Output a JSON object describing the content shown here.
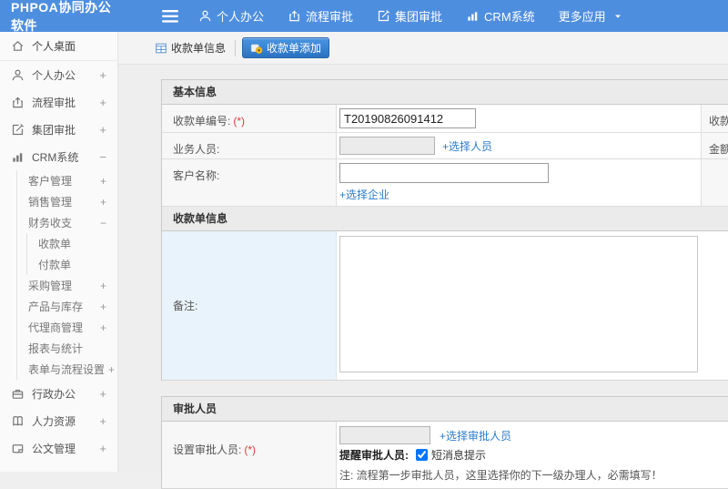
{
  "header": {
    "logo": "PHPOA协同办公软件",
    "nav": [
      {
        "label": "个人办公",
        "icon": "user-icon"
      },
      {
        "label": "流程审批",
        "icon": "process-icon"
      },
      {
        "label": "集团审批",
        "icon": "edit-icon"
      },
      {
        "label": "CRM系统",
        "icon": "chart-icon"
      },
      {
        "label": "更多应用",
        "icon": "caret-down-icon"
      }
    ]
  },
  "sidebar": {
    "items": [
      {
        "label": "个人桌面",
        "icon": "home-icon",
        "expand": ""
      },
      {
        "label": "个人办公",
        "icon": "user-icon",
        "expand": "+"
      },
      {
        "label": "流程审批",
        "icon": "process-icon",
        "expand": "+"
      },
      {
        "label": "集团审批",
        "icon": "edit-icon",
        "expand": "+"
      },
      {
        "label": "CRM系统",
        "icon": "chart-icon",
        "expand": "−"
      },
      {
        "label": "行政办公",
        "icon": "briefcase-icon",
        "expand": "+"
      },
      {
        "label": "人力资源",
        "icon": "book-icon",
        "expand": "+"
      },
      {
        "label": "公文管理",
        "icon": "doc-icon",
        "expand": "+"
      }
    ],
    "crm_children": [
      {
        "label": "客户管理",
        "expand": "+"
      },
      {
        "label": "销售管理",
        "expand": "+"
      },
      {
        "label": "财务收支",
        "expand": "−"
      },
      {
        "label": "采购管理",
        "expand": "+"
      },
      {
        "label": "产品与库存",
        "expand": "+"
      },
      {
        "label": "代理商管理",
        "expand": "+"
      },
      {
        "label": "报表与统计",
        "expand": ""
      },
      {
        "label": "表单与流程设置",
        "expand": "+"
      }
    ],
    "finance_children": [
      {
        "label": "收款单"
      },
      {
        "label": "付款单"
      }
    ]
  },
  "tabs": [
    {
      "label": "收款单信息",
      "icon": "table-icon"
    },
    {
      "label": "收款单添加",
      "icon": "add-receipt-icon"
    }
  ],
  "form": {
    "basic": {
      "title": "基本信息",
      "receipt_no": {
        "label": "收款单编号:",
        "required": "(*)",
        "value": "T20190826091412",
        "right_label": "收款单"
      },
      "sales_person": {
        "label": "业务人员:",
        "value": "",
        "link": "+选择人员",
        "right_label": "金额:"
      },
      "customer": {
        "label": "客户名称:",
        "value": "",
        "link": "+选择企业"
      }
    },
    "receipt_info": {
      "title": "收款单信息",
      "remark": {
        "label": "备注:",
        "value": ""
      }
    },
    "approval": {
      "title": "审批人员",
      "approver": {
        "label": "设置审批人员:",
        "required": "(*)",
        "value": "",
        "link": "+选择审批人员"
      },
      "remind": {
        "label": "提醒审批人员:",
        "checkbox_label": "短消息提示",
        "checked_attr": "checked"
      },
      "note": "注: 流程第一步审批人员，这里选择你的下一级办理人，必需填写！"
    }
  }
}
